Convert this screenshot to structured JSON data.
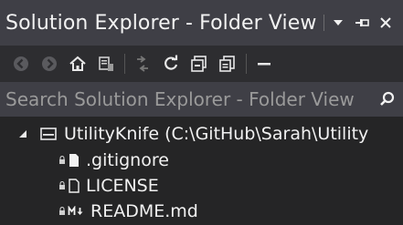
{
  "window": {
    "title": "Solution Explorer - Folder View",
    "controls": {
      "dropdown": "▾",
      "pin": "⊣",
      "close": "✕"
    }
  },
  "toolbar": {
    "buttons": [
      "back-icon",
      "forward-icon",
      "home-icon",
      "switch-views-icon",
      "pending-changes-icon",
      "refresh-icon",
      "collapse-all-icon",
      "show-all-files-icon",
      "properties-icon"
    ]
  },
  "search": {
    "placeholder": "Search Solution Explorer - Folder View"
  },
  "tree": {
    "root": {
      "label": "UtilityKnife (C:\\GitHub\\Sarah\\Utility",
      "expanded": true
    },
    "items": [
      {
        "label": ".gitignore",
        "icon": "file-filled-icon"
      },
      {
        "label": "LICENSE",
        "icon": "file-icon"
      },
      {
        "label": "README.md",
        "icon": "markdown-icon"
      }
    ]
  },
  "colors": {
    "title_bg": "#3f3f46",
    "toolbar_bg": "#2d2d30",
    "panel_bg": "#252526",
    "text": "#f1f1f1",
    "placeholder": "#9a9a9a"
  }
}
